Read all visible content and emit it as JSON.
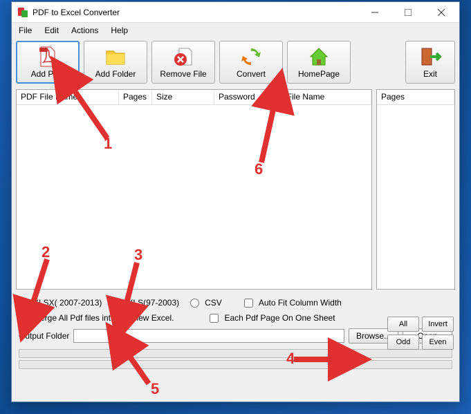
{
  "window": {
    "title": "PDF to Excel Converter"
  },
  "menubar": {
    "items": [
      "File",
      "Edit",
      "Actions",
      "Help"
    ]
  },
  "toolbar": {
    "add_pdf": "Add PDF",
    "add_folder": "Add Folder",
    "remove_file": "Remove File",
    "convert": "Convert",
    "homepage": "HomePage",
    "exit": "Exit"
  },
  "main_list": {
    "columns": {
      "name": "PDF File Name",
      "pages": "Pages",
      "size": "Size",
      "password": "Password",
      "full": "Full File Name"
    },
    "rows": []
  },
  "side_list": {
    "column": "Pages",
    "rows": []
  },
  "format": {
    "xlsx": "XLSX( 2007-2013)",
    "xls": "XLS(97-2003)",
    "csv": "CSV",
    "autofit": "Auto Fit Column Width",
    "merge": "Merge All Pdf files into one new Excel.",
    "each_page": "Each Pdf Page On One Sheet",
    "selected": "xlsx",
    "autofit_checked": false,
    "merge_checked": false,
    "each_page_checked": false
  },
  "side_buttons": {
    "all": "All",
    "invert": "Invert",
    "odd": "Odd",
    "even": "Even"
  },
  "output": {
    "label": "Output Folder",
    "value": "",
    "browse": "Browse...",
    "open": "Open"
  },
  "annotations": {
    "a1": "1",
    "a2": "2",
    "a3": "3",
    "a4": "4",
    "a5": "5",
    "a6": "6"
  }
}
